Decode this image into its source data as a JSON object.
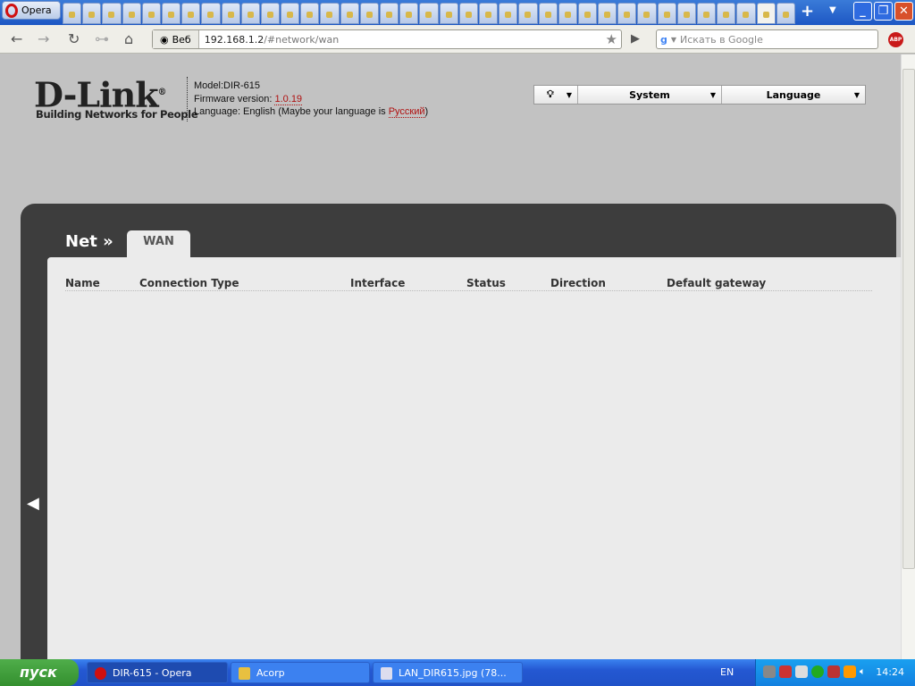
{
  "browser": {
    "name": "Opera",
    "address_scheme_label": "Веб",
    "url_host": "192.168.1.2",
    "url_path": "/#network/wan",
    "search_placeholder": "Искать в Google",
    "abp": "ABP"
  },
  "header": {
    "logo": "D-Link",
    "logo_reg": "®",
    "tagline": "Building Networks for People",
    "model": "Model:DIR-615",
    "firmware_label": "Firmware version: ",
    "firmware": "1.0.19",
    "language_prefix": "Language: English (Maybe your language is ",
    "language_suggest": "Русский",
    "language_suffix": ")"
  },
  "menus": {
    "system": "System",
    "language": "Language"
  },
  "section": {
    "title": "Net »",
    "tab": "WAN"
  },
  "table": {
    "columns": [
      "Name",
      "Connection Type",
      "Interface",
      "Status",
      "Direction",
      "Default gateway"
    ],
    "rows": []
  },
  "taskbar": {
    "start": "пуск",
    "tasks": [
      "DIR-615 - Opera",
      "Acorp",
      "LAN_DIR615.jpg (78..."
    ],
    "lang": "EN",
    "clock": "14:24"
  }
}
